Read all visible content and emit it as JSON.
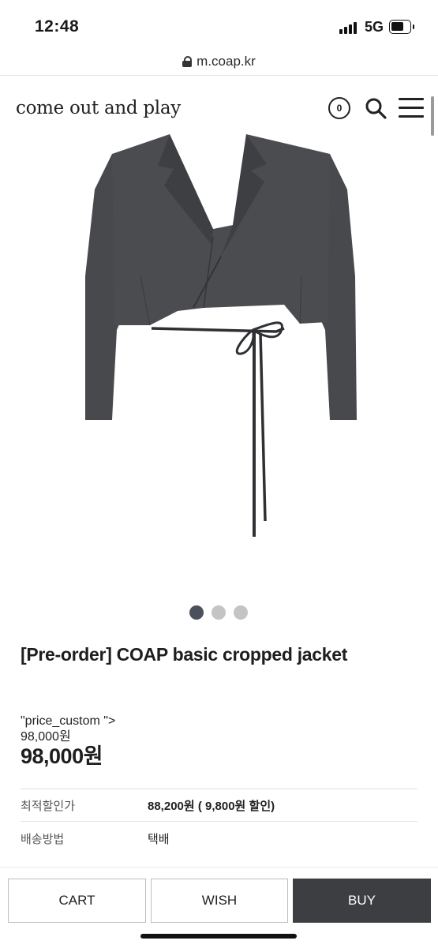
{
  "status_bar": {
    "time": "12:48",
    "network": "5G"
  },
  "browser": {
    "url": "m.coap.kr"
  },
  "header": {
    "logo": "come out and play",
    "cart_count": "0"
  },
  "carousel": {
    "total": 3,
    "active": 1
  },
  "product": {
    "title": "[Pre-order] COAP basic cropped jacket",
    "price_custom_raw": "\"price_custom \">",
    "price_custom_value": "98,000원",
    "price": "98,000원"
  },
  "info_rows": [
    {
      "label": "최적할인가",
      "value": "88,200원 ( 9,800원 할인)"
    },
    {
      "label": "배송방법",
      "value": "택배"
    }
  ],
  "actions": {
    "cart": "CART",
    "wish": "WISH",
    "buy": "BUY"
  },
  "colors": {
    "buy_button": "#3d3e42",
    "jacket": "#4a4b4f",
    "active_dot": "#4c505a"
  }
}
